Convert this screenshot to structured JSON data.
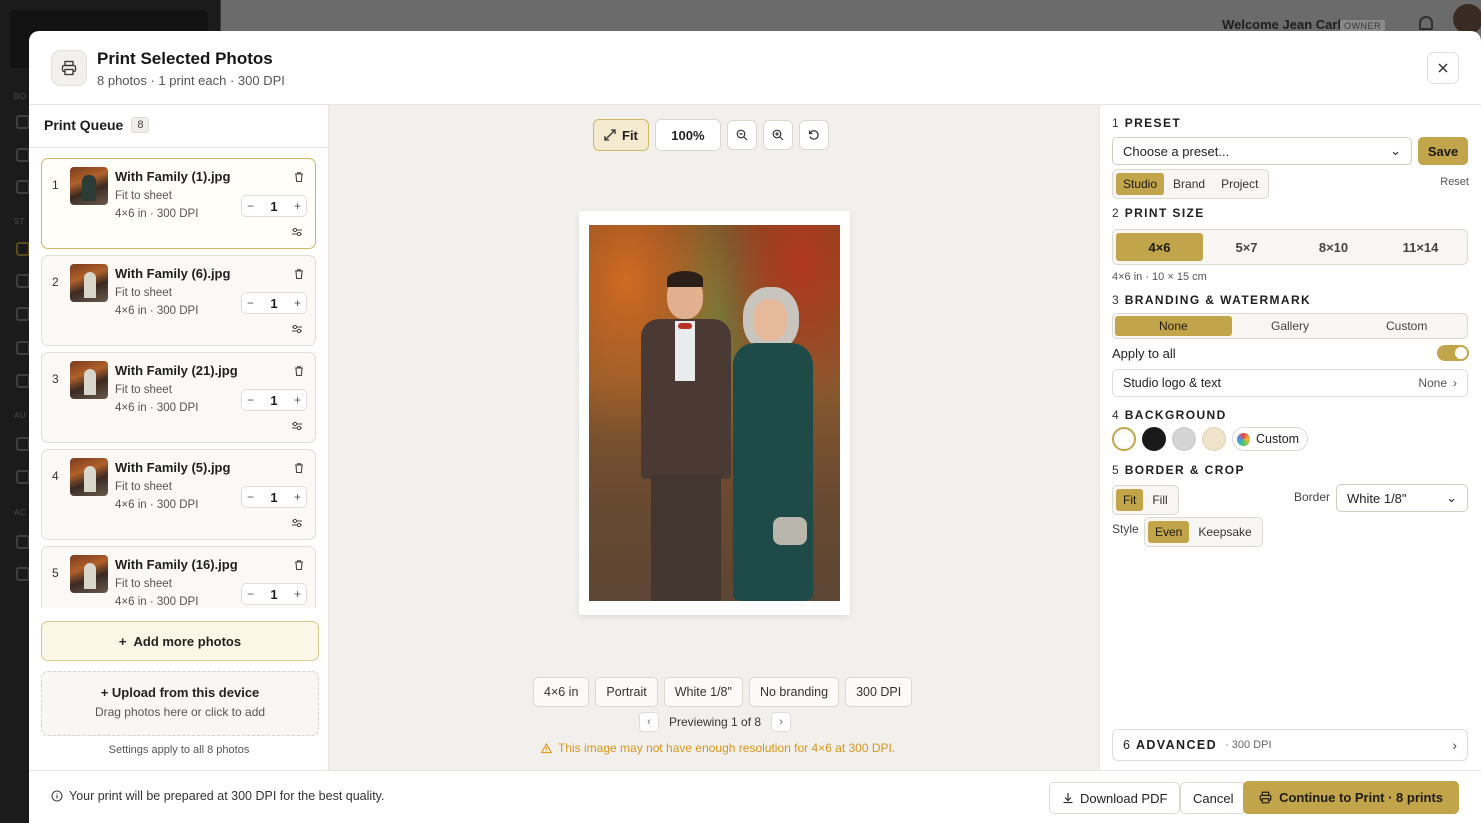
{
  "background": {
    "welcome": "Welcome Jean Carlo",
    "role_badge": "OWNER"
  },
  "header": {
    "title": "Print Selected Photos",
    "subtitle": "8 photos · 1 print each · 300 DPI"
  },
  "queue": {
    "title": "Print Queue",
    "count": "8",
    "items": [
      {
        "num": "1",
        "name": "With Family (1).jpg",
        "fit": "Fit to sheet",
        "meta": "4×6 in  ·  300 DPI",
        "qty": "1"
      },
      {
        "num": "2",
        "name": "With Family (6).jpg",
        "fit": "Fit to sheet",
        "meta": "4×6 in  ·  300 DPI",
        "qty": "1"
      },
      {
        "num": "3",
        "name": "With Family (21).jpg",
        "fit": "Fit to sheet",
        "meta": "4×6 in  ·  300 DPI",
        "qty": "1"
      },
      {
        "num": "4",
        "name": "With Family (5).jpg",
        "fit": "Fit to sheet",
        "meta": "4×6 in  ·  300 DPI",
        "qty": "1"
      },
      {
        "num": "5",
        "name": "With Family (16).jpg",
        "fit": "Fit to sheet",
        "meta": "4×6 in  ·  300 DPI",
        "qty": "1"
      }
    ],
    "add_more": "Add more photos",
    "upload_title": "Upload from this device",
    "upload_sub": "Drag photos here or click to add",
    "settings_note": "Settings apply to all 8 photos"
  },
  "preview": {
    "fit_label": "Fit",
    "zoom": "100%",
    "chips": [
      "4×6 in",
      "Portrait",
      "White 1/8\"",
      "No branding",
      "300 DPI"
    ],
    "pager": "Previewing 1 of 8",
    "warning": "This image may not have enough resolution for 4×6 at 300 DPI."
  },
  "settings": {
    "preset": {
      "num": "1",
      "title": "PRESET",
      "placeholder": "Choose a preset...",
      "save": "Save",
      "tabs": [
        "Studio",
        "Brand",
        "Project"
      ],
      "active_tab": "Studio",
      "reset": "Reset"
    },
    "print_size": {
      "num": "2",
      "title": "PRINT SIZE",
      "options": [
        "4×6",
        "5×7",
        "8×10",
        "11×14"
      ],
      "selected": "4×6",
      "note": "4×6 in · 10 × 15 cm"
    },
    "branding": {
      "num": "3",
      "title": "BRANDING & WATERMARK",
      "options": [
        "None",
        "Gallery",
        "Custom"
      ],
      "selected": "None",
      "apply_all": "Apply to all",
      "apply_all_on": true,
      "studio_logo_label": "Studio logo & text",
      "studio_logo_value": "None"
    },
    "background": {
      "num": "4",
      "title": "BACKGROUND",
      "swatches": [
        "#ffffff",
        "#1a1a1a",
        "#d4d4d4",
        "#efe4c9"
      ],
      "custom": "Custom"
    },
    "border_crop": {
      "num": "5",
      "title": "BORDER & CROP",
      "mode_options": [
        "Fit",
        "Fill"
      ],
      "mode_selected": "Fit",
      "border_label": "Border",
      "border_value": "White 1/8\"",
      "style_label": "Style",
      "style_options": [
        "Even",
        "Keepsake"
      ],
      "style_selected": "Even"
    },
    "advanced": {
      "num": "6",
      "title": "ADVANCED",
      "dpi": "· 300 DPI"
    }
  },
  "footer": {
    "note": "Your print will be prepared at 300 DPI for the best quality.",
    "download": "Download PDF",
    "cancel": "Cancel",
    "continue": "Continue to Print · 8 prints"
  },
  "colors": {
    "accent": "#c2a54a",
    "warning": "#d9961a"
  }
}
